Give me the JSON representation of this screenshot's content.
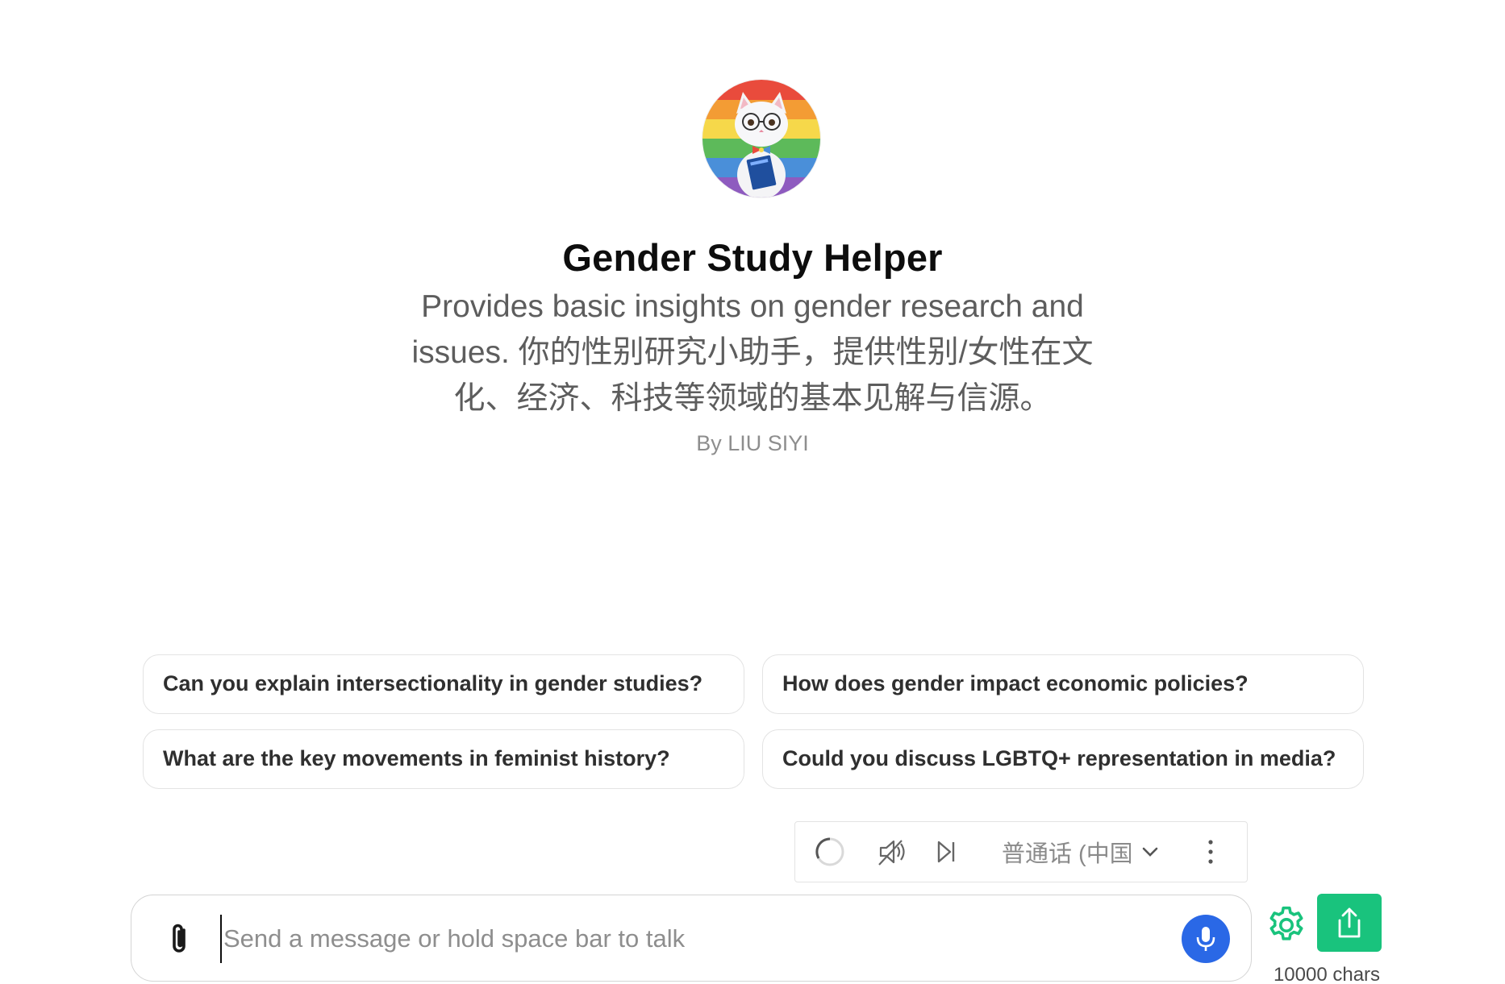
{
  "gpt": {
    "name": "Gender Study Helper",
    "description": "Provides basic insights on gender research and issues. 你的性别研究小助手，提供性别/女性在文化、经济、科技等领域的基本见解与信源。",
    "author": "By LIU SIYI"
  },
  "starters": [
    "Can you explain intersectionality in gender studies?",
    "How does gender impact economic policies?",
    "What are the key movements in feminist history?",
    "Could you discuss LGBTQ+ representation in media?"
  ],
  "voice_toolbar": {
    "language": "普通话 (中国大陆)"
  },
  "composer": {
    "placeholder": "Send a message or hold space bar to talk",
    "value": ""
  },
  "char_counter": "10000 chars",
  "colors": {
    "mic_button": "#2a68e6",
    "share_button": "#19c37d",
    "settings_icon": "#19c37d"
  },
  "icons": {
    "attach": "paperclip-icon",
    "mic": "microphone-icon",
    "settings": "gear-icon",
    "share": "share-icon",
    "spinner": "loading-spinner-icon",
    "mute": "speaker-muted-icon",
    "skip": "skip-next-icon",
    "more": "more-vertical-icon"
  }
}
